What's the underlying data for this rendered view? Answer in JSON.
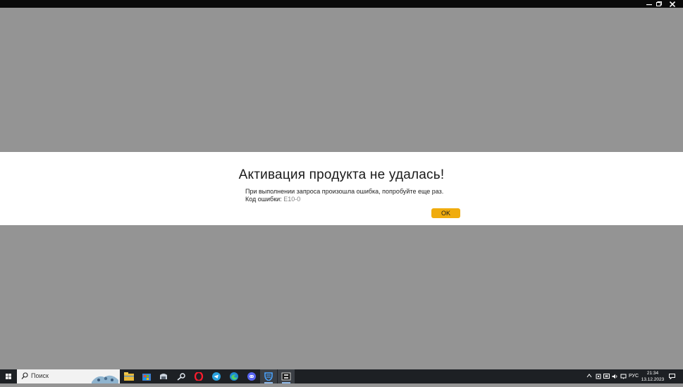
{
  "window": {
    "minimize_icon": "minimize-icon",
    "restore_icon": "restore-icon",
    "close_icon": "close-icon"
  },
  "dialog": {
    "title": "Активация продукта не удалась!",
    "message": "При выполнении запроса произошла ошибка, попробуйте еще раз.",
    "code_label": "Код ошибки: ",
    "code_value": "E10-0",
    "ok_label": "OK",
    "ok_color": "#f0ac0e"
  },
  "taskbar": {
    "search_placeholder": "Поиск",
    "apps": [
      "file-explorer-icon",
      "store-icon",
      "mail-icon",
      "steam-icon",
      "opera-icon",
      "telegram-icon",
      "edge-icon",
      "discord-icon",
      "shield-icon",
      "game-icon"
    ],
    "tray": {
      "language": "РУС",
      "time": "21:34",
      "date": "13.12.2023"
    }
  }
}
